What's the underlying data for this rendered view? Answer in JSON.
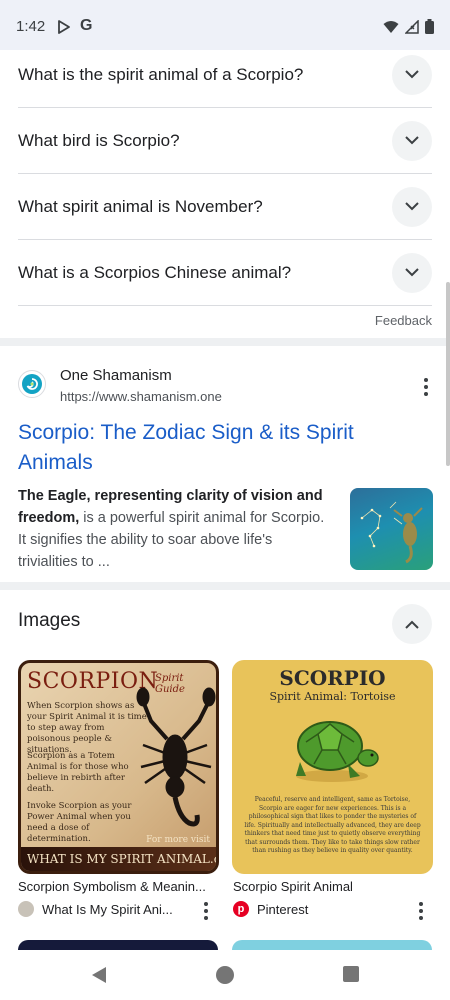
{
  "status_bar": {
    "time": "1:42",
    "g_label": "G"
  },
  "faq": [
    {
      "question": "What is the spirit animal of a Scorpio?"
    },
    {
      "question": "What bird is Scorpio?"
    },
    {
      "question": "What spirit animal is November?"
    },
    {
      "question": "What is a Scorpios Chinese animal?"
    }
  ],
  "feedback_label": "Feedback",
  "result": {
    "site_name": "One Shamanism",
    "site_url": "https://www.shamanism.one",
    "title": "Scorpio: The Zodiac Sign & its Spirit Animals",
    "snippet_bold": "The Eagle, representing clarity of vision and freedom,",
    "snippet_rest": " is a powerful spirit animal for Scorpio. It signifies the ability to soar above life's trivialities to ..."
  },
  "images_section": {
    "title": "Images",
    "items": [
      {
        "caption": "Scorpion Symbolism & Meanin...",
        "source": "What Is My Spirit Ani...",
        "image_text": {
          "title": "SCORPION",
          "subtitle": "Spirit Guide",
          "para1": "When Scorpion shows as your Spirit Animal it is time to step away from poisonous people & situations.",
          "para2": "Scorpion as a Totem Animal is for those who believe in rebirth after death.",
          "para3": "Invoke Scorpion as your Power Animal when you need a dose of determination.",
          "more": "For more visit",
          "footer": "WHAT IS MY SPIRIT ANIMAL.com"
        }
      },
      {
        "caption": "Scorpio Spirit Animal",
        "source": "Pinterest",
        "image_text": {
          "title": "SCORPIO",
          "subtitle": "Spirit Animal: Tortoise",
          "body": "Peaceful, reserve and intelligent, same as Tortoise, Scorpio are eager for new experiences. This is a philosophical sign that likes to ponder the mysteries of life. Spiritually and intellectually advanced, they are deep thinkers that need time just to quietly observe everything that surrounds them. They like to take things slow rather than rushing as they believe in quality over quantity."
        }
      }
    ]
  },
  "colors": {
    "link_blue": "#1a5dc8",
    "status_bar_bg": "#eef1f8",
    "pinterest_red": "#e60023"
  }
}
